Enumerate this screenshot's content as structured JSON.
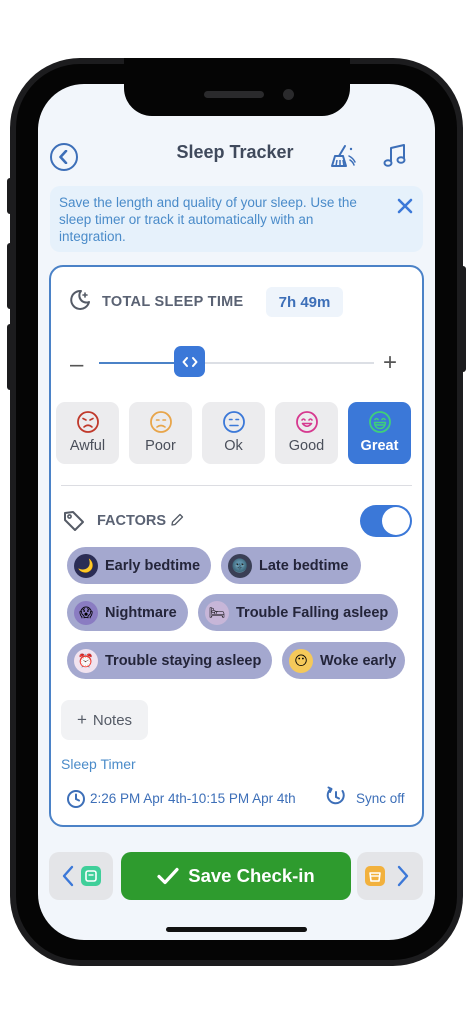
{
  "header": {
    "title": "Sleep Tracker",
    "back_icon": "chevron-left-icon",
    "sweep_icon": "broom-sparkle-icon",
    "music_icon": "music-note-icon"
  },
  "banner": {
    "text": "Save the length and quality of your sleep. Use the sleep timer or track it automatically with an integration.",
    "close_icon": "close-icon"
  },
  "total_sleep": {
    "label": "TOTAL SLEEP TIME",
    "value": "7h 49m",
    "slider_minus": "–",
    "slider_plus": "+",
    "slider_level": 0.33
  },
  "moods": [
    {
      "label": "Awful",
      "color": "#c0392b",
      "face": "angry"
    },
    {
      "label": "Poor",
      "color": "#e8a54a",
      "face": "sad"
    },
    {
      "label": "Ok",
      "color": "#3b78d8",
      "face": "neutral"
    },
    {
      "label": "Good",
      "color": "#d6398f",
      "face": "happy"
    },
    {
      "label": "Great",
      "color": "#3fcf7a",
      "face": "grin",
      "selected": true
    }
  ],
  "factors": {
    "label": "FACTORS",
    "enabled": true,
    "chips": [
      {
        "label": "Early bedtime",
        "emoji": "🌙"
      },
      {
        "label": "Late bedtime",
        "emoji": "🌚"
      },
      {
        "label": "Nightmare",
        "emoji": "😱"
      },
      {
        "label": "Trouble Falling asleep",
        "emoji": "🛏"
      },
      {
        "label": "Trouble staying asleep",
        "emoji": "⏰"
      },
      {
        "label": "Woke early",
        "emoji": "😶"
      }
    ]
  },
  "notes": {
    "label": "Notes",
    "plus": "+"
  },
  "sleep_timer": {
    "label": "Sleep Timer",
    "range": "2:26 PM Apr 4th-10:15 PM Apr 4th",
    "sync": "Sync off"
  },
  "bottom": {
    "save_label": "Save Check-in",
    "prev_icon": "chevron-left-icon",
    "next_icon": "chevron-right-icon"
  },
  "colors": {
    "accent": "#3b78d8",
    "save_green": "#2e9b2e",
    "chip_purple": "#a4a8cf"
  }
}
